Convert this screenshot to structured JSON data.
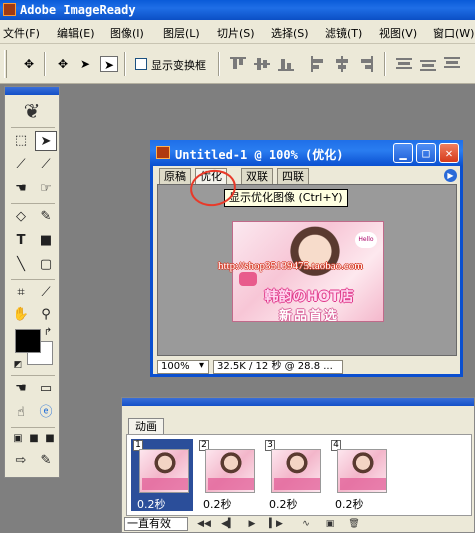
{
  "app": {
    "title": "Adobe ImageReady"
  },
  "menu": [
    "文件(F)",
    "编辑(E)",
    "图像(I)",
    "图层(L)",
    "切片(S)",
    "选择(S)",
    "滤镜(T)",
    "视图(V)",
    "窗口(W)"
  ],
  "options_bar": {
    "show_transform_label": "显示变换框",
    "show_transform_checked": false
  },
  "document": {
    "title": "Untitled-1 @ 100% (优化)",
    "tabs": [
      "原稿",
      "优化",
      "双联",
      "四联"
    ],
    "active_tab": "优化",
    "tooltip": "显示优化图像 (Ctrl+Y)",
    "image_url_overlay": "http://shop35139475.taobao.com",
    "image_texts": {
      "shop_name": "韩韵のHOT店",
      "bubble": "Hello",
      "subtitle": "新品首选"
    },
    "zoom": "100%",
    "size_info": "32.5K / 12 秒 @ 28.8 ..."
  },
  "animation": {
    "tab_label": "动画",
    "frames": [
      {
        "number": "1",
        "delay": "0.2秒",
        "selected": true
      },
      {
        "number": "2",
        "delay": "0.2秒",
        "selected": false
      },
      {
        "number": "3",
        "delay": "0.2秒",
        "selected": false
      },
      {
        "number": "4",
        "delay": "0.2秒",
        "selected": false
      }
    ],
    "loop": "一直有效"
  }
}
